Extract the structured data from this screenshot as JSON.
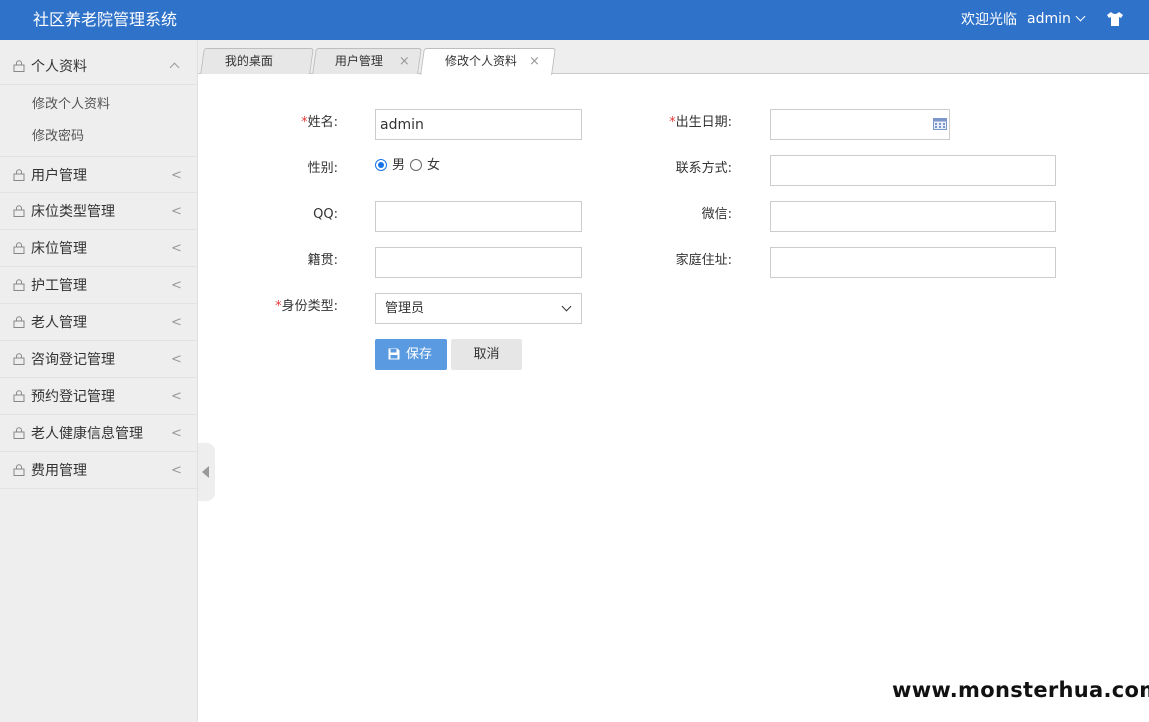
{
  "app": {
    "title": "社区养老院管理系统",
    "welcome": "欢迎光临",
    "username": "admin"
  },
  "sidebar": {
    "groups": [
      {
        "label": "个人资料",
        "expanded": true,
        "items": [
          "修改个人资料",
          "修改密码"
        ]
      },
      {
        "label": "用户管理",
        "arrow": "<"
      },
      {
        "label": "床位类型管理",
        "arrow": "<"
      },
      {
        "label": "床位管理",
        "arrow": "<"
      },
      {
        "label": "护工管理",
        "arrow": "<"
      },
      {
        "label": "老人管理",
        "arrow": "<"
      },
      {
        "label": "咨询登记管理",
        "arrow": "<"
      },
      {
        "label": "预约登记管理",
        "arrow": "<"
      },
      {
        "label": "老人健康信息管理",
        "arrow": "<"
      },
      {
        "label": "费用管理",
        "arrow": "<"
      }
    ]
  },
  "tabs": [
    {
      "label": "我的桌面",
      "closable": false,
      "active": false
    },
    {
      "label": "用户管理",
      "closable": true,
      "active": false,
      "close": "×"
    },
    {
      "label": "修改个人资料",
      "closable": true,
      "active": true,
      "close": "×"
    }
  ],
  "form": {
    "name_label": "姓名:",
    "name_value": "admin",
    "birth_label": "出生日期:",
    "birth_value": "",
    "gender_label": "性别:",
    "gender_options": [
      "男",
      "女"
    ],
    "gender_selected": "男",
    "contact_label": "联系方式:",
    "contact_value": "",
    "qq_label": "QQ:",
    "qq_value": "",
    "wechat_label": "微信:",
    "wechat_value": "",
    "origin_label": "籍贯:",
    "origin_value": "",
    "address_label": "家庭住址:",
    "address_value": "",
    "role_label": "身份类型:",
    "role_value": "管理员",
    "required_mark": "*",
    "save_label": "保存",
    "cancel_label": "取消"
  },
  "watermark": "www.monsterhua.com",
  "colors": {
    "header": "#2f72c9",
    "sidebar": "#eeeeee",
    "save_button": "#5a9ae0",
    "required": "#e4393c"
  }
}
